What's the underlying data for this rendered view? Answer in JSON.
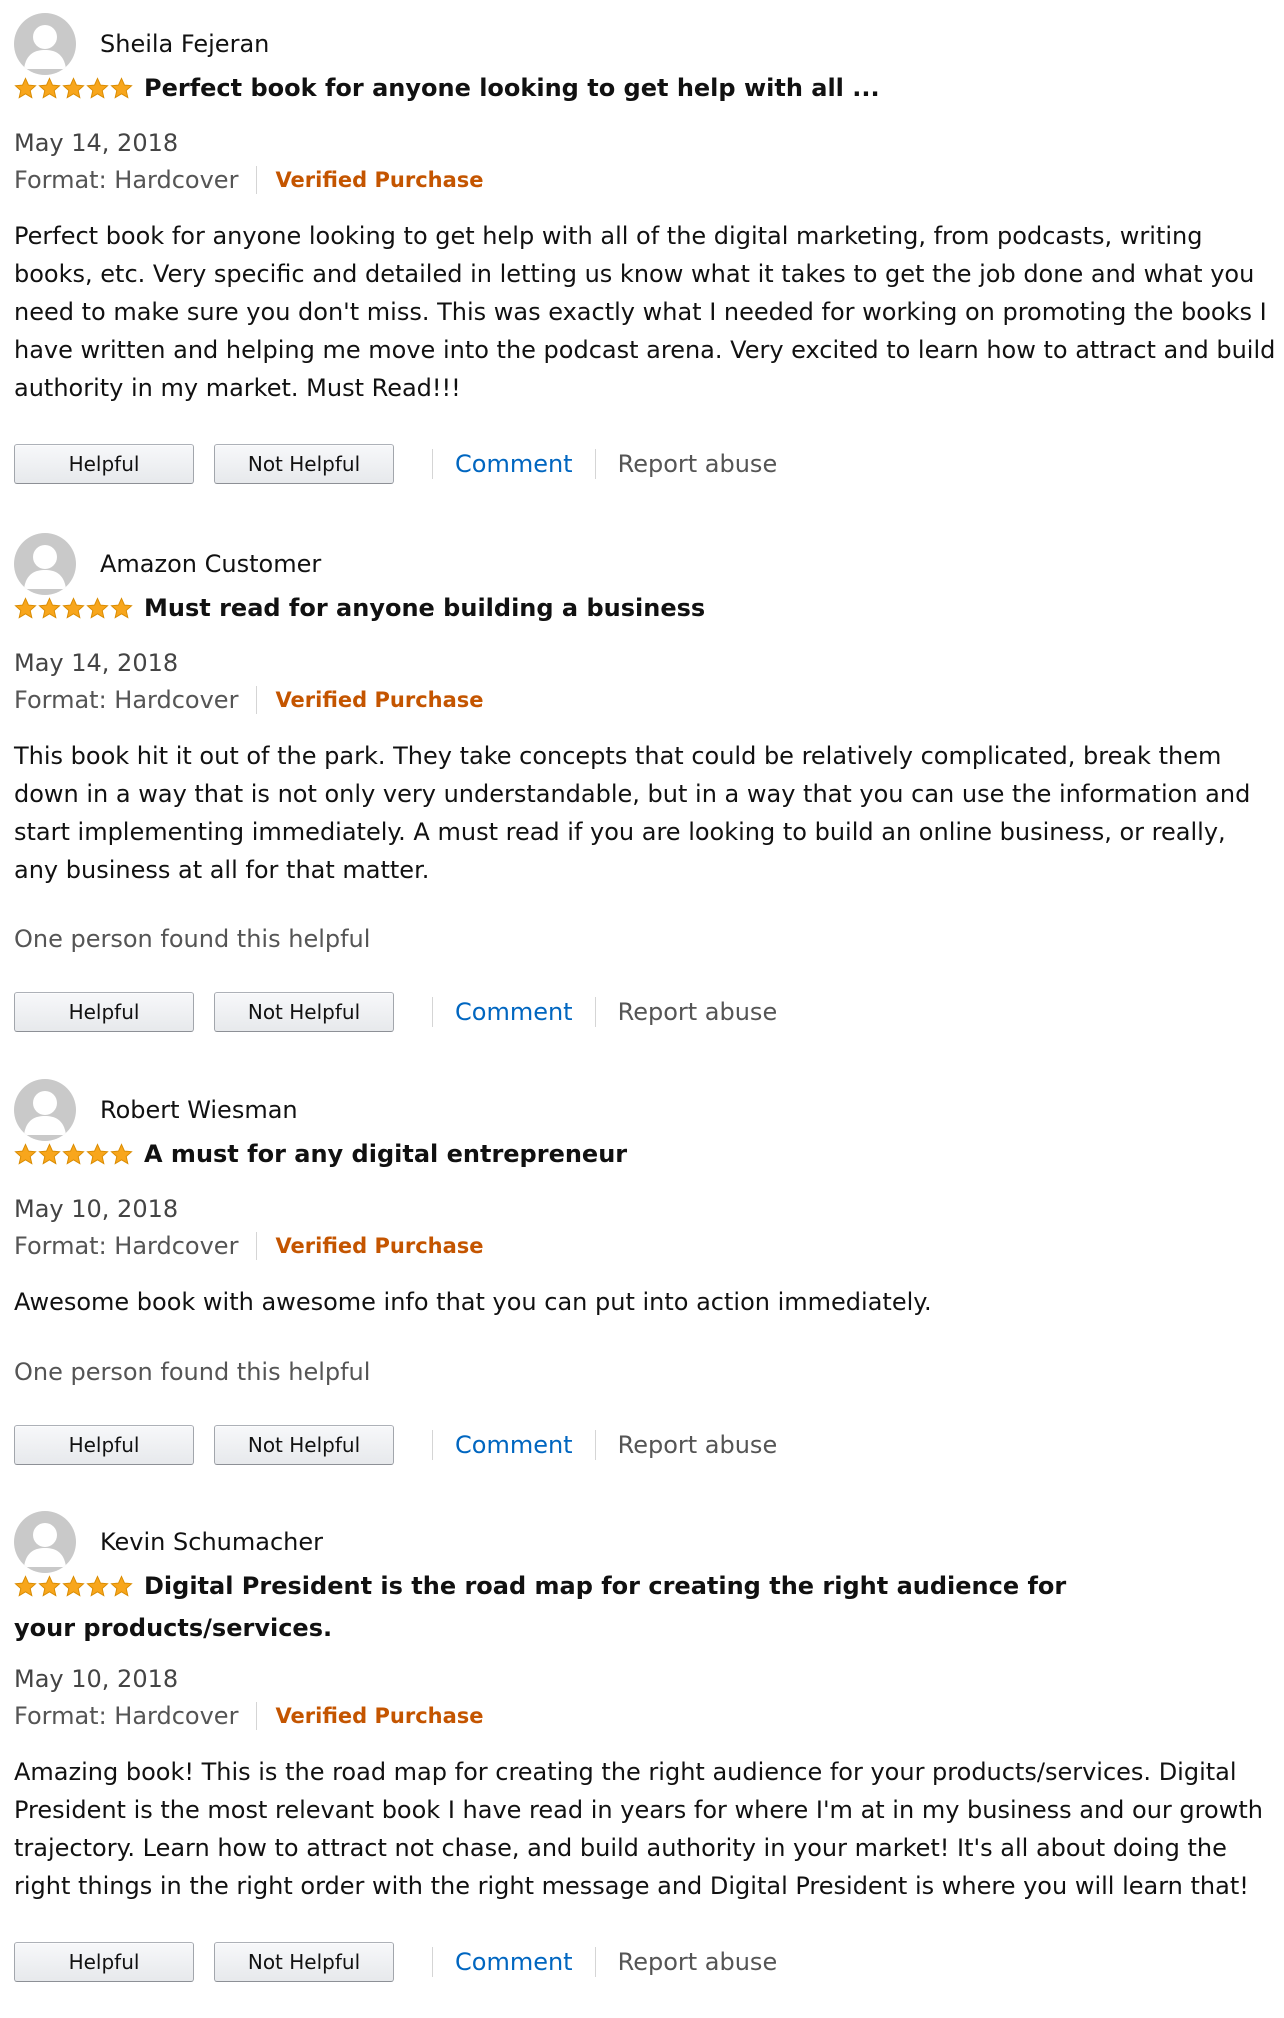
{
  "colors": {
    "star": "#f8a61c",
    "verified": "#c45500",
    "link": "#0066c0",
    "muted": "#555555"
  },
  "labels": {
    "helpful": "Helpful",
    "not_helpful": "Not Helpful",
    "comment": "Comment",
    "report_abuse": "Report abuse",
    "format": "Format: Hardcover",
    "verified_purchase": "Verified Purchase"
  },
  "reviews": [
    {
      "name": "Sheila Fejeran",
      "rating": 5,
      "title": "Perfect book for anyone looking to get help with all ...",
      "date": "May 14, 2018",
      "body": "Perfect book for anyone looking to get help with all of the digital marketing, from podcasts, writing books, etc. Very specific and detailed in letting us know what it takes to get the job done and what you need to make sure you don't miss. This was exactly what I needed for working on promoting the books I have written and helping me move into the podcast arena. Very excited to learn how to attract and build authority in my market. Must Read!!!",
      "helpful_count": ""
    },
    {
      "name": "Amazon Customer",
      "rating": 5,
      "title": "Must read for anyone building a business",
      "date": "May 14, 2018",
      "body": "This book hit it out of the park. They take concepts that could be relatively complicated, break them down in a way that is not only very understandable, but in a way that you can use the information and start implementing immediately. A must read if you are looking to build an online business, or really, any business at all for that matter.",
      "helpful_count": "One person found this helpful"
    },
    {
      "name": "Robert Wiesman",
      "rating": 5,
      "title": "A must for any digital entrepreneur",
      "date": "May 10, 2018",
      "body": "Awesome book with awesome info that you can put into action immediately.",
      "helpful_count": "One person found this helpful"
    },
    {
      "name": "Kevin Schumacher",
      "rating": 5,
      "title": "Digital President is the road map for creating the right audience for your products/services.",
      "date": "May 10, 2018",
      "body": "Amazing book! This is the road map for creating the right audience for your products/services. Digital President is the most relevant book I have read in years for where I'm at in my business and our growth trajectory. Learn how to attract not chase, and build authority in your market! It's all about doing the right things in the right order with the right message and Digital President is where you will learn that!",
      "helpful_count": ""
    }
  ]
}
